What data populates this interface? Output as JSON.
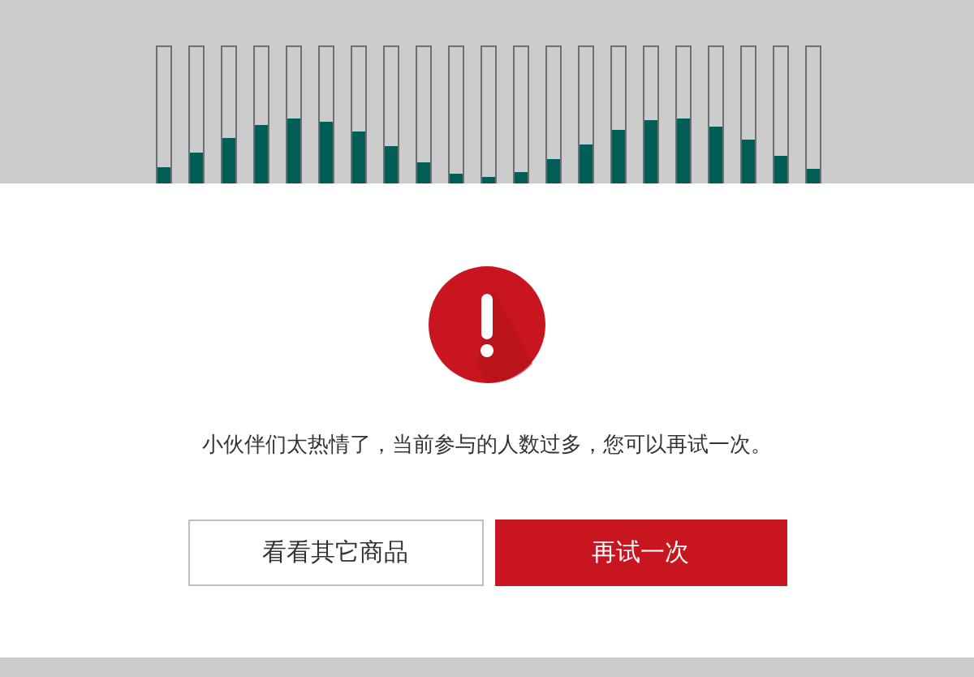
{
  "dialog": {
    "message": "小伙伴们太热情了，当前参与的人数过多，您可以再试一次。",
    "buttons": [
      {
        "label": "看看其它商品",
        "kind": "secondary"
      },
      {
        "label": "再试一次",
        "kind": "primary"
      }
    ]
  }
}
